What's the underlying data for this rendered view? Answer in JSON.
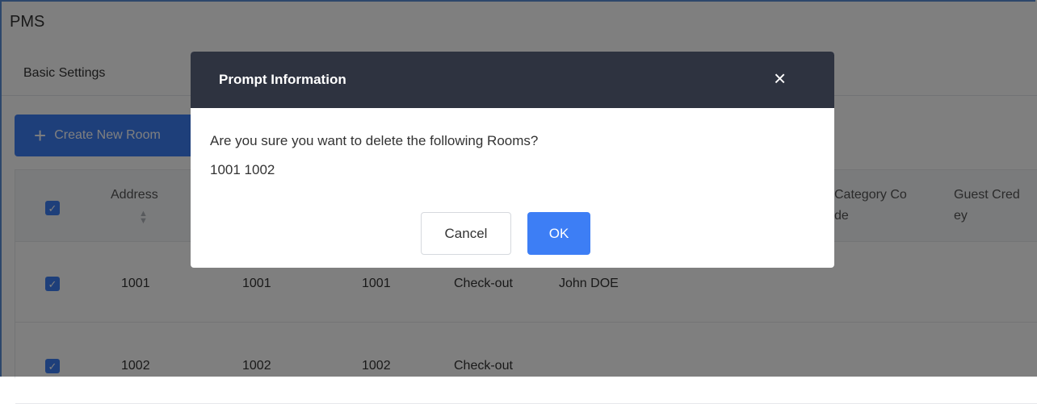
{
  "page": {
    "title": "PMS"
  },
  "tabs": {
    "basic_settings": "Basic Settings"
  },
  "toolbar": {
    "create_label": "Create New Room",
    "create_icon": "plus-icon"
  },
  "table": {
    "headers": [
      {
        "label": "Address",
        "sortable": true
      },
      {
        "label": "Category Co\nde",
        "sortable": false
      },
      {
        "label": "Guest Cred\ney",
        "sortable": false
      }
    ],
    "rows": [
      {
        "checked": true,
        "cells": [
          "1001",
          "1001",
          "1001",
          "Check-out",
          "John DOE"
        ]
      },
      {
        "checked": true,
        "cells": [
          "1002",
          "1002",
          "1002",
          "Check-out",
          ""
        ]
      }
    ]
  },
  "modal": {
    "title": "Prompt Information",
    "close_icon": "close-icon",
    "message": "Are you sure you want to delete the following Rooms?",
    "rooms": "1001 1002",
    "cancel_label": "Cancel",
    "ok_label": "OK"
  },
  "colors": {
    "accent": "#3d7ef5",
    "modal_header": "#2e3340"
  }
}
